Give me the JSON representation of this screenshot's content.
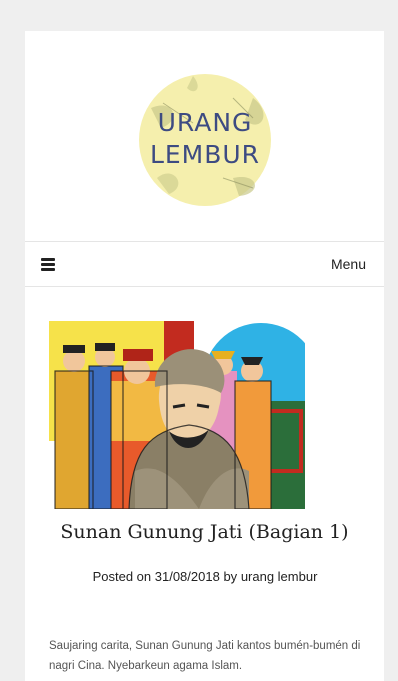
{
  "site": {
    "logo_line1": "URANG",
    "logo_line2": "LEMBUR"
  },
  "nav": {
    "menu_label": "Menu",
    "menu_icon": "hamburger-icon"
  },
  "post": {
    "title": "Sunan Gunung Jati (Bagian 1)",
    "posted_on_label": "Posted on",
    "date": "31/08/2018",
    "by_label": "by",
    "author": "urang lembur",
    "excerpt": "Saujaring carita, Sunan Gunung Jati kantos bumén-bumén di nagri Cina. Nyebarkeun agama Islam."
  },
  "colors": {
    "page_bg": "#efefef",
    "card_bg": "#ffffff",
    "logo_circle": "#f4eeaa",
    "logo_text": "#3d4b82"
  }
}
